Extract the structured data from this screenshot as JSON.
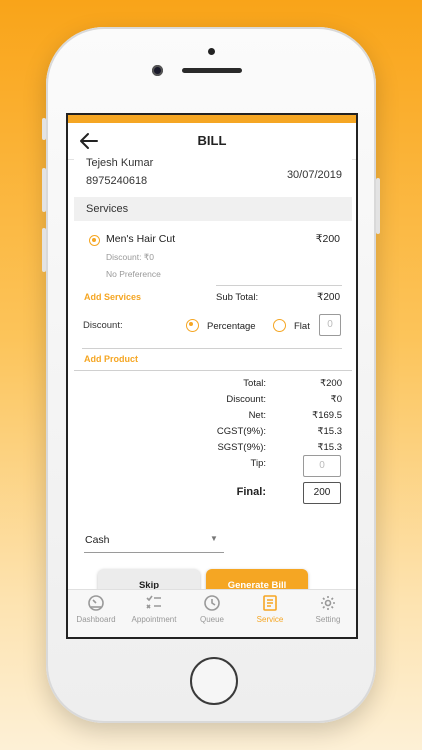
{
  "header": {
    "title": "BILL"
  },
  "customer": {
    "name": "Tejesh Kumar",
    "phone": "8975240618",
    "date": "30/07/2019"
  },
  "services": {
    "section_title": "Services",
    "items": [
      {
        "name": "Men's Hair Cut",
        "price": "₹200",
        "discount": "Discount: ₹0",
        "preference": "No Preference"
      }
    ],
    "add_services_label": "Add Services",
    "subtotal_label": "Sub Total:",
    "subtotal_value": "₹200"
  },
  "discount": {
    "label": "Discount:",
    "options": [
      {
        "label": "Percentage",
        "selected": true
      },
      {
        "label": "Flat",
        "selected": false
      }
    ],
    "placeholder": "0"
  },
  "add_product_label": "Add Product",
  "summary": {
    "rows": [
      {
        "label": "Total:",
        "value": "₹200"
      },
      {
        "label": "Discount:",
        "value": "₹0"
      },
      {
        "label": "Net:",
        "value": "₹169.5"
      },
      {
        "label": "CGST(9%):",
        "value": "₹15.3"
      },
      {
        "label": "SGST(9%):",
        "value": "₹15.3"
      }
    ],
    "tip_label": "Tip:",
    "tip_placeholder": "0",
    "final_label": "Final:",
    "final_value": "200"
  },
  "payment": {
    "selected": "Cash"
  },
  "actions": {
    "skip": "Skip",
    "generate": "Generate Bill"
  },
  "nav": {
    "items": [
      {
        "label": "Dashboard",
        "icon": "dashboard-icon",
        "active": false
      },
      {
        "label": "Appointment",
        "icon": "appointment-icon",
        "active": false
      },
      {
        "label": "Queue",
        "icon": "clock-icon",
        "active": false
      },
      {
        "label": "Service",
        "icon": "service-icon",
        "active": true
      },
      {
        "label": "Setting",
        "icon": "gear-icon",
        "active": false
      }
    ]
  },
  "colors": {
    "accent": "#f5a623",
    "background_top": "#f9a419"
  }
}
